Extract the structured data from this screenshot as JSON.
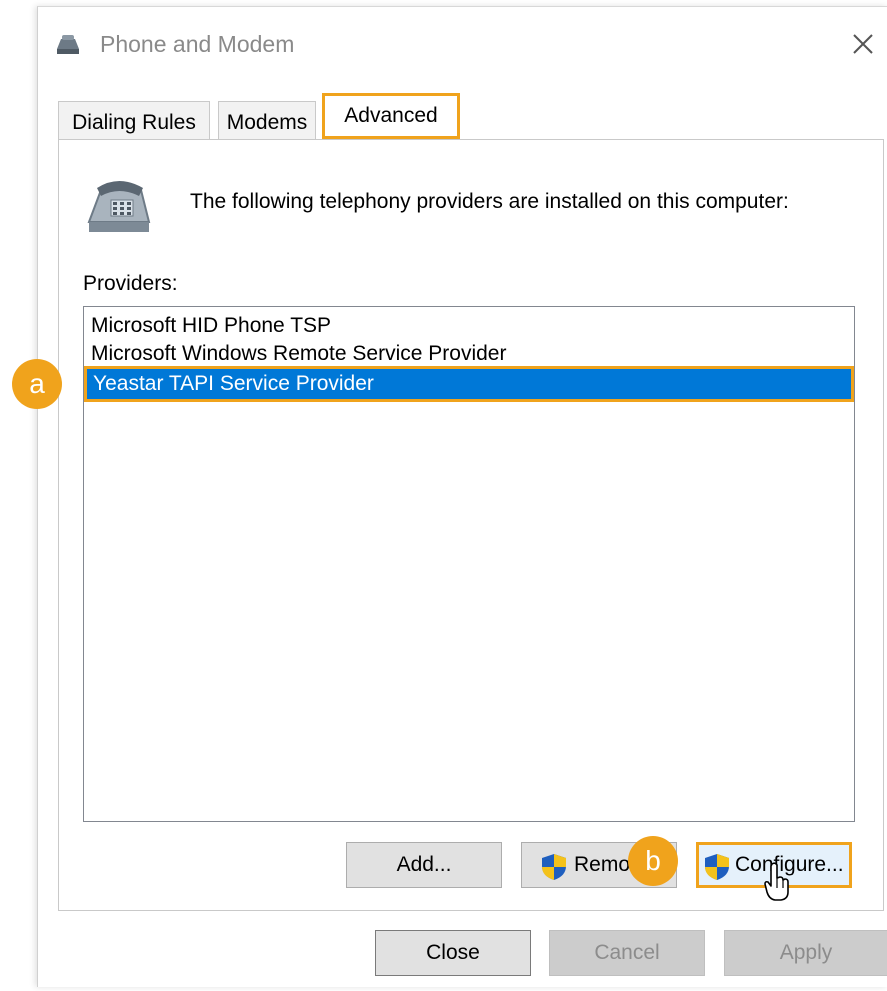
{
  "window": {
    "title": "Phone and Modem"
  },
  "tabs": [
    {
      "label": "Dialing Rules"
    },
    {
      "label": "Modems"
    },
    {
      "label": "Advanced"
    }
  ],
  "panel": {
    "info_text": "The following telephony providers are installed on this computer:",
    "providers_label": "Providers:",
    "providers": [
      {
        "label": "Microsoft HID Phone TSP"
      },
      {
        "label": "Microsoft Windows Remote Service Provider"
      },
      {
        "label": "Yeastar TAPI Service Provider"
      }
    ],
    "buttons": {
      "add": "Add...",
      "remove": "Remove",
      "configure": "Configure..."
    }
  },
  "footer": {
    "close": "Close",
    "cancel": "Cancel",
    "apply": "Apply"
  },
  "callouts": {
    "a": "a",
    "b": "b"
  },
  "colors": {
    "highlight": "#f0a31c",
    "selection": "#0078d7",
    "button_face": "#e1e1e1"
  },
  "icons": [
    "phone-modem-icon",
    "close-icon",
    "telephone-icon",
    "uac-shield-icon",
    "hand-cursor-icon"
  ]
}
